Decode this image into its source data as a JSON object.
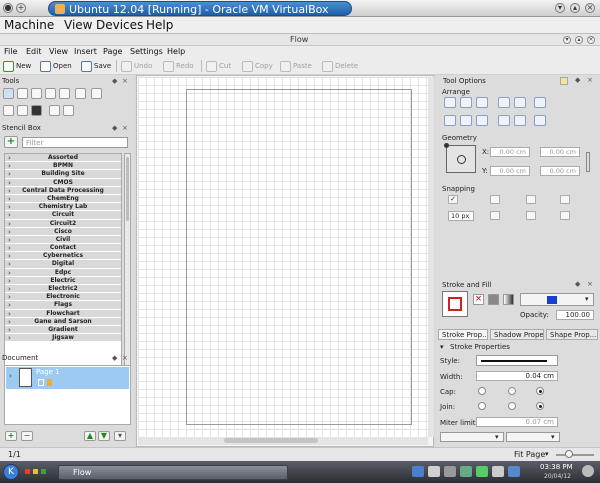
{
  "host": {
    "title": "Ubuntu 12.04 [Running] - Oracle VM VirtualBox",
    "menu": [
      "Machine",
      "View",
      "Devices",
      "Help"
    ]
  },
  "guest": {
    "title": "Flow",
    "menu": [
      "File",
      "Edit",
      "View",
      "Insert",
      "Page",
      "Settings",
      "Help"
    ],
    "toolbar": {
      "new": "New",
      "open": "Open",
      "save": "Save",
      "undo": "Undo",
      "redo": "Redo",
      "cut": "Cut",
      "copy": "Copy",
      "paste": "Paste",
      "delete": "Delete"
    }
  },
  "left": {
    "tools_title": "Tools",
    "stencil_title": "Stencil Box",
    "filter_placeholder": "Filter",
    "stencils": [
      "Assorted",
      "BPMN",
      "Building Site",
      "CMOS",
      "Central Data Processing",
      "ChemEng",
      "Chemistry Lab",
      "Circuit",
      "Circuit2",
      "Cisco",
      "Civil",
      "Contact",
      "Cybernetics",
      "Digital",
      "Edpc",
      "Electric",
      "Electric2",
      "Electronic",
      "Flags",
      "Flowchart",
      "Gane and Sarson",
      "Gradient",
      "Jigsaw"
    ],
    "document_title": "Document",
    "page_label": "Page 1"
  },
  "right": {
    "tool_options": "Tool Options",
    "arrange": "Arrange",
    "geometry": "Geometry",
    "x_label": "X:",
    "y_label": "Y:",
    "geom_val": "0.00 cm",
    "snapping": "Snapping",
    "snap_size": "10 px",
    "stroke_fill": "Stroke and Fill",
    "opacity_label": "Opacity:",
    "opacity_value": "100.00",
    "tabs": [
      "Stroke Prop...",
      "Shadow Prope...",
      "Shape Prop..."
    ],
    "stroke_properties": "Stroke Properties",
    "style_label": "Style:",
    "width_label": "Width:",
    "width_value": "0.04 cm",
    "cap_label": "Cap:",
    "join_label": "Join:",
    "miter_label": "Miter limit:",
    "miter_value": "0.07 cm",
    "accent_color": "#1a3fd0"
  },
  "status": {
    "page_count": "1/1",
    "zoom": "Fit Page"
  },
  "taskbar": {
    "task": "Flow",
    "time": "03:38 PM",
    "date": "20/04/12"
  }
}
